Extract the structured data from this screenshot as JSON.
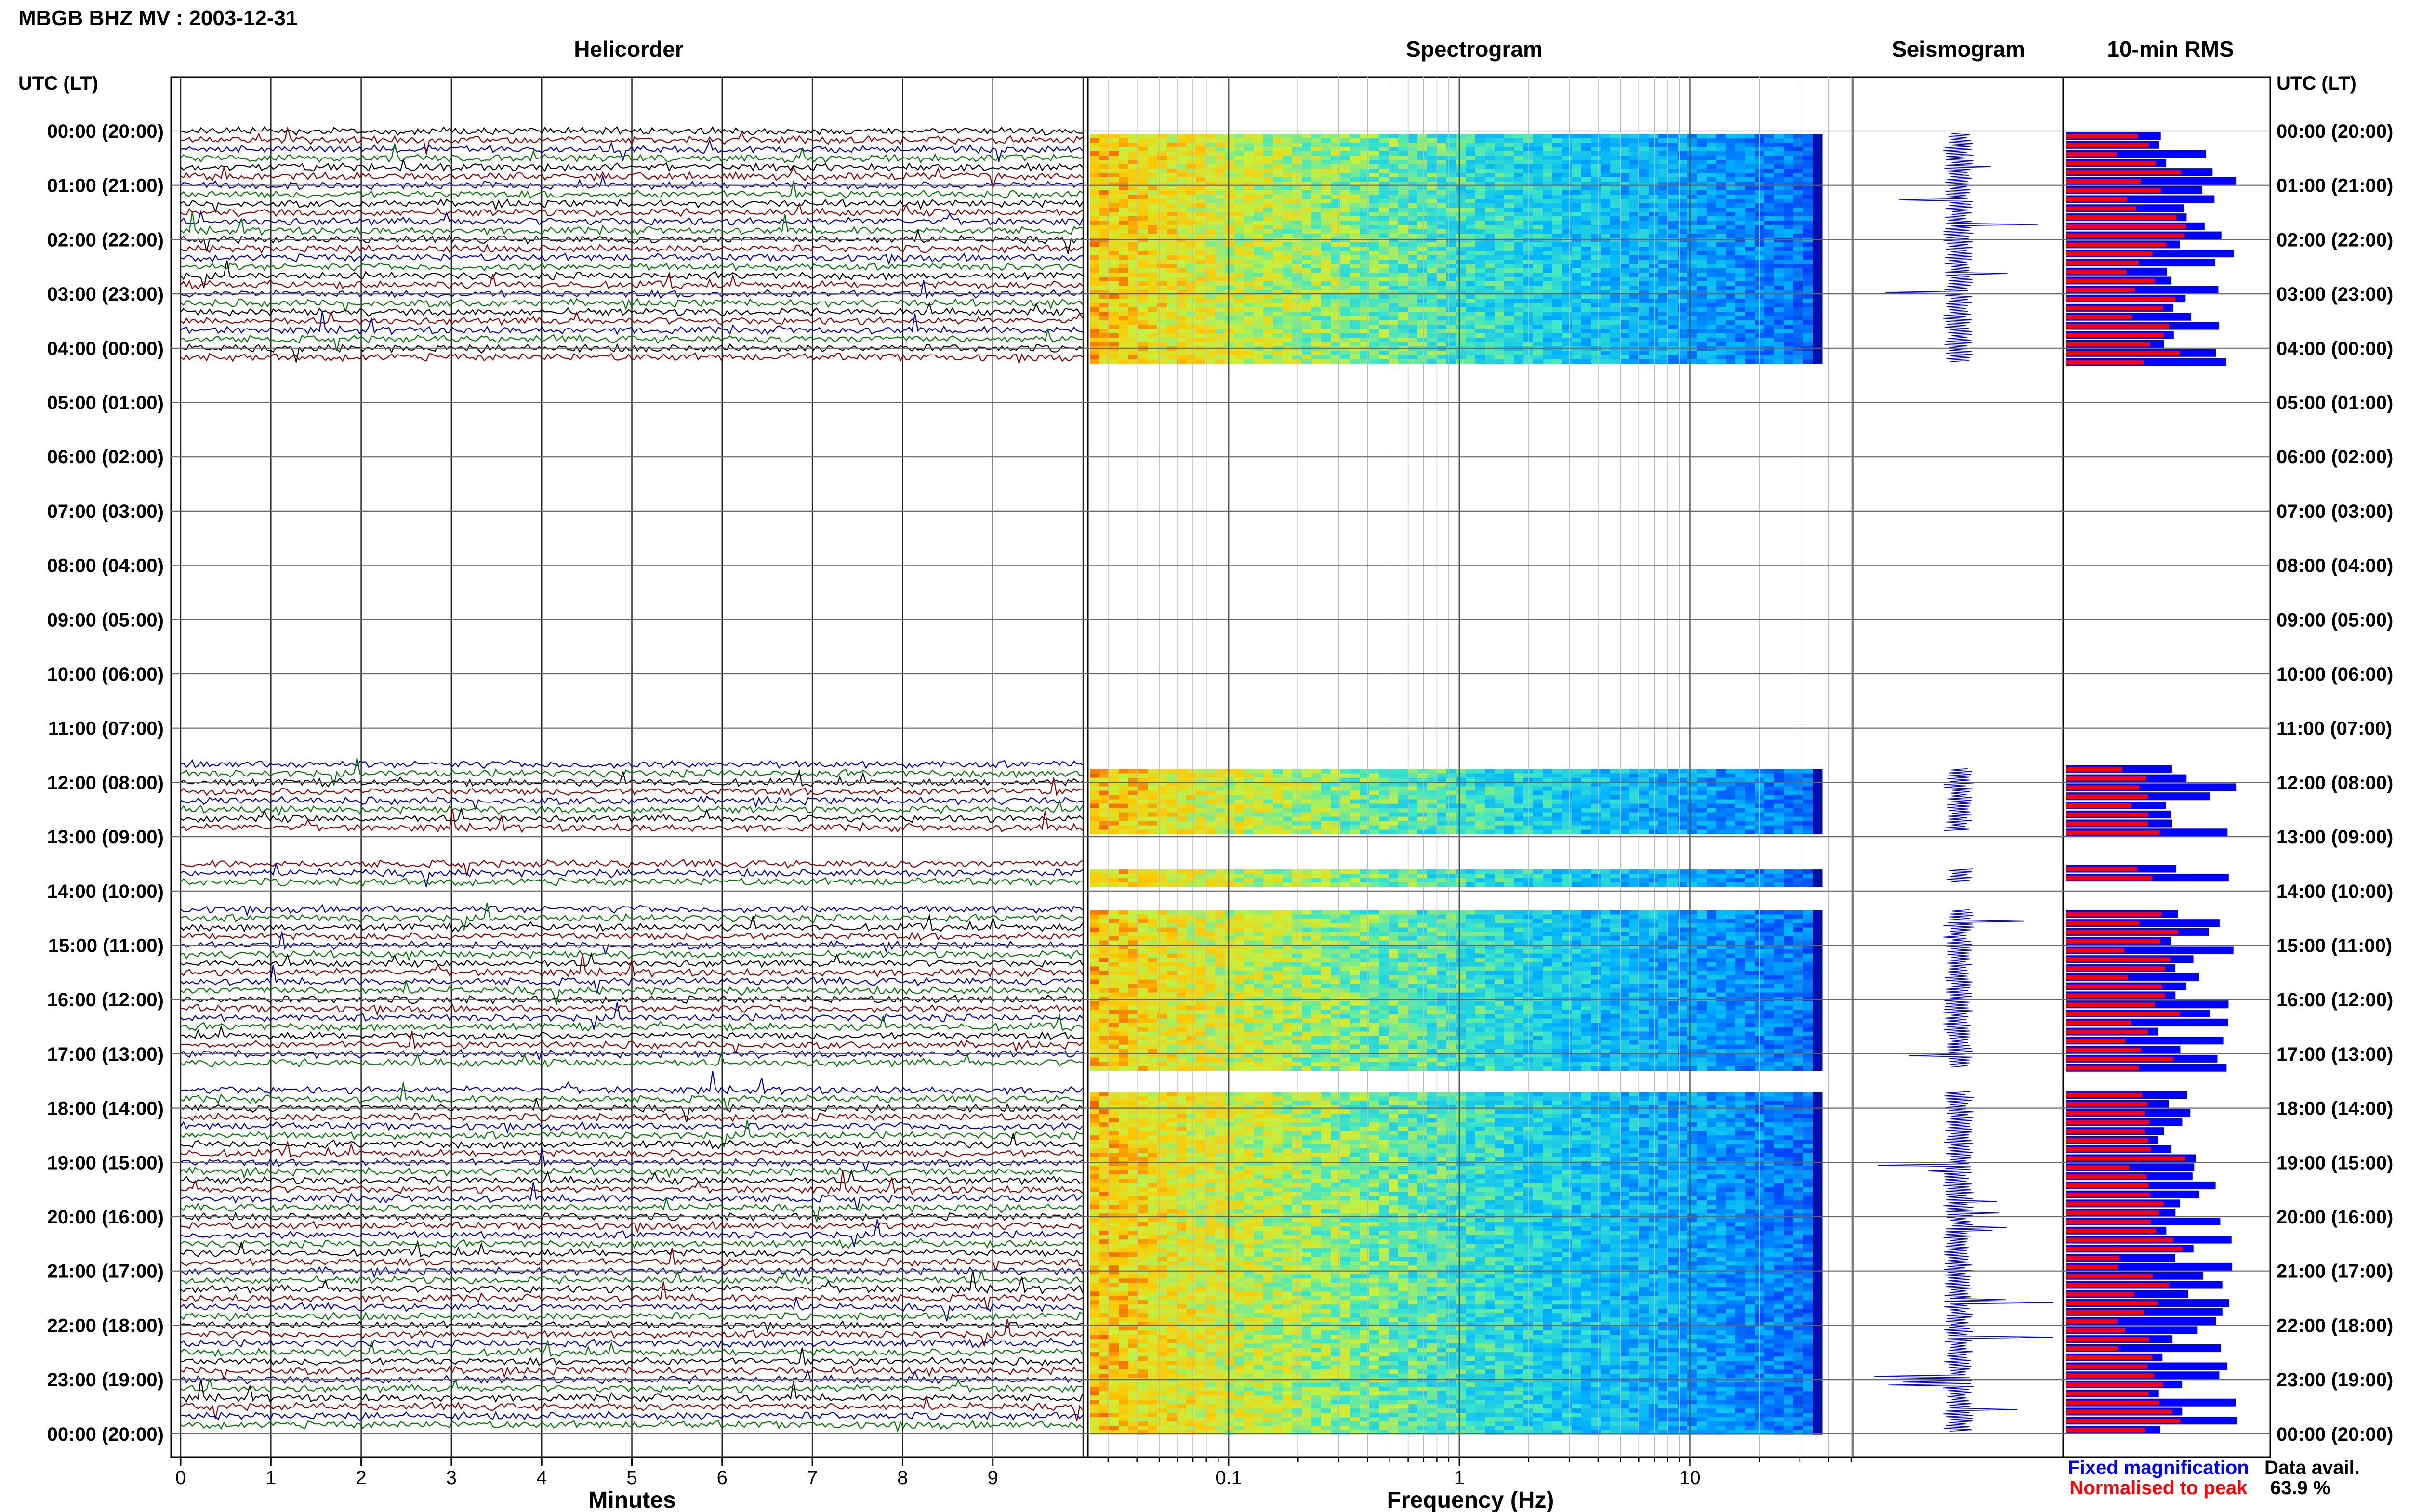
{
  "page": {
    "title": "MBGB BHZ MV : 2003-12-31",
    "utc_lt_label": "UTC (LT)",
    "utc_lt_label_right": "UTC (LT)"
  },
  "panels": {
    "helicorder": "Helicorder",
    "spectrogram": "Spectrogram",
    "seismogram": "Seismogram",
    "rms": "10-min RMS"
  },
  "colors": {
    "trace": [
      "#000000",
      "#8b0000",
      "#0000aa",
      "#007700"
    ],
    "rms_fixed": "#0000ff",
    "rms_normalised": "#ff0000"
  },
  "chart_data": {
    "type": "helicorder",
    "hours": [
      "00:00 (20:00)",
      "01:00 (21:00)",
      "02:00 (22:00)",
      "03:00 (23:00)",
      "04:00 (00:00)",
      "05:00 (01:00)",
      "06:00 (02:00)",
      "07:00 (03:00)",
      "08:00 (04:00)",
      "09:00 (05:00)",
      "10:00 (06:00)",
      "11:00 (07:00)",
      "12:00 (08:00)",
      "13:00 (09:00)",
      "14:00 (10:00)",
      "15:00 (11:00)",
      "16:00 (12:00)",
      "17:00 (13:00)",
      "18:00 (14:00)",
      "19:00 (15:00)",
      "20:00 (16:00)",
      "21:00 (17:00)",
      "22:00 (18:00)",
      "23:00 (19:00)",
      "00:00 (20:00)"
    ],
    "data_segments_hours": [
      [
        0,
        4.3
      ],
      [
        11.7,
        12.95
      ],
      [
        13.55,
        13.9
      ],
      [
        14.3,
        17.3
      ],
      [
        17.65,
        24
      ]
    ],
    "helicorder_xaxis": {
      "label": "Minutes",
      "ticks": [
        "0",
        "1",
        "2",
        "3",
        "4",
        "5",
        "6",
        "7",
        "8",
        "9"
      ],
      "range": [
        0,
        10
      ]
    },
    "spectrogram_xaxis": {
      "label": "Frequency (Hz)",
      "ticks": [
        "0.1",
        "1",
        "10"
      ],
      "scale": "log",
      "range": [
        0.025,
        50
      ]
    },
    "rms": {
      "series": [
        {
          "name": "Fixed magnification",
          "color": "#0000ff"
        },
        {
          "name": "Normalised to peak",
          "color": "#ff0000"
        }
      ]
    },
    "data_availability": {
      "label": "Data avail.",
      "value": "63.9 %"
    }
  }
}
